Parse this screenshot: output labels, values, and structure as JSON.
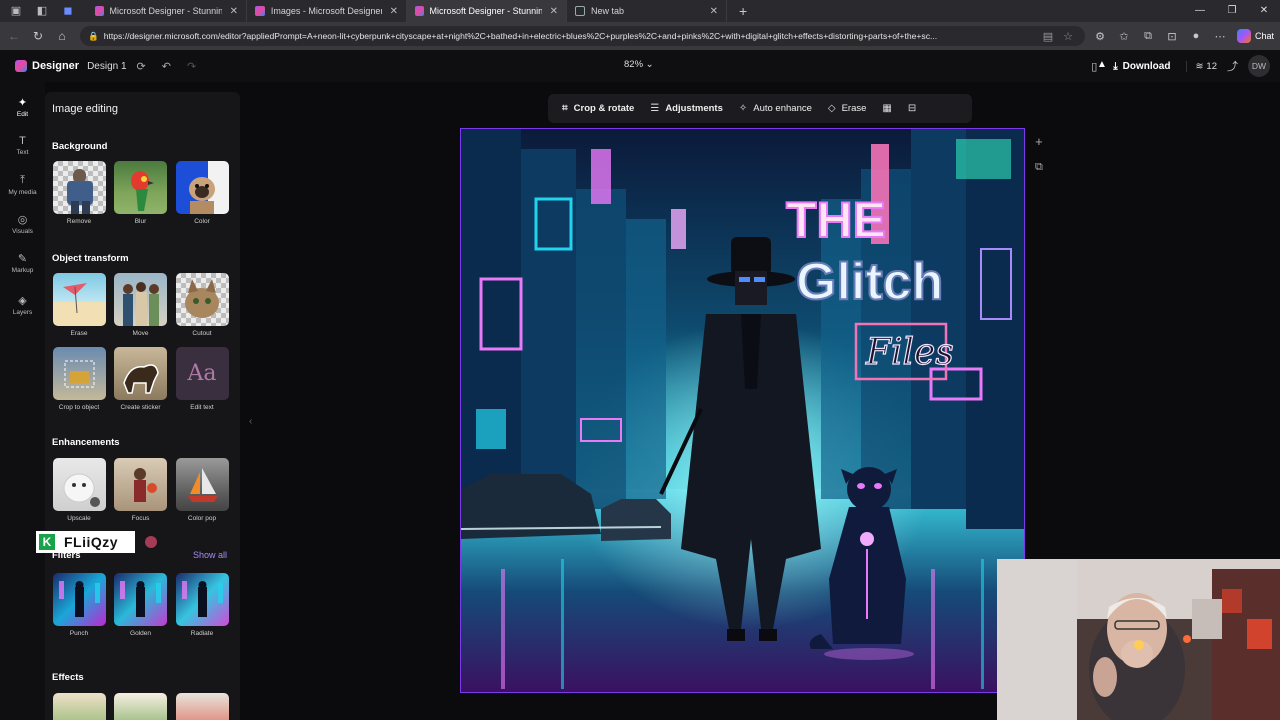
{
  "browser": {
    "tabs": [
      {
        "title": "Microsoft Designer - Stunning de",
        "icon": "designer-favicon",
        "active": false
      },
      {
        "title": "Images - Microsoft Designer",
        "icon": "designer-favicon",
        "active": false
      },
      {
        "title": "Microsoft Designer - Stunning de",
        "icon": "designer-favicon",
        "active": true
      },
      {
        "title": "New tab",
        "icon": "page-icon",
        "active": false
      }
    ],
    "url": "https://designer.microsoft.com/editor?appliedPrompt=A+neon-lit+cyberpunk+cityscape+at+night%2C+bathed+in+electric+blues%2C+purples%2C+and+pinks%2C+with+digital+glitch+effects+distorting+parts+of+the+sc...",
    "chat_label": "Chat"
  },
  "header": {
    "brand": "Designer",
    "doc_name": "Design 1",
    "zoom": "82%",
    "download_label": "Download",
    "count": "12",
    "avatar_initials": "DW"
  },
  "rail": [
    {
      "label": "Edit",
      "icon": "edit-icon",
      "active": true
    },
    {
      "label": "Text",
      "icon": "text-icon",
      "active": false
    },
    {
      "label": "My media",
      "icon": "upload-icon",
      "active": false
    },
    {
      "label": "Visuals",
      "icon": "visuals-icon",
      "active": false
    },
    {
      "label": "Markup",
      "icon": "pen-icon",
      "active": false
    },
    {
      "label": "Layers",
      "icon": "layers-icon",
      "active": false
    }
  ],
  "panel": {
    "title": "Image editing",
    "sections": {
      "background": {
        "title": "Background",
        "items": [
          "Remove",
          "Blur",
          "Color"
        ]
      },
      "object_transform": {
        "title": "Object transform",
        "items": [
          "Erase",
          "Move",
          "Cutout",
          "Crop to object",
          "Create sticker",
          "Edit text"
        ]
      },
      "enhancements": {
        "title": "Enhancements",
        "items": [
          "Upscale",
          "Focus",
          "Color pop"
        ]
      },
      "filters": {
        "title": "Filters",
        "show_all": "Show all",
        "items": [
          "Punch",
          "Golden",
          "Radiate"
        ]
      },
      "effects": {
        "title": "Effects"
      }
    },
    "edit_text_glyph": "Aa"
  },
  "overlay_badge": {
    "letter": "K",
    "text": "FLiiQzy"
  },
  "canvas_toolbar": {
    "crop": "Crop & rotate",
    "adjustments": "Adjustments",
    "auto_enhance": "Auto enhance",
    "erase": "Erase"
  },
  "artwork": {
    "line1": "THE",
    "line2": "Glitch",
    "line3": "Files"
  },
  "colors": {
    "accent": "#7c3aed",
    "link": "#a78bfa",
    "neon_cyan": "#22d3ee",
    "neon_pink": "#e879f9"
  }
}
